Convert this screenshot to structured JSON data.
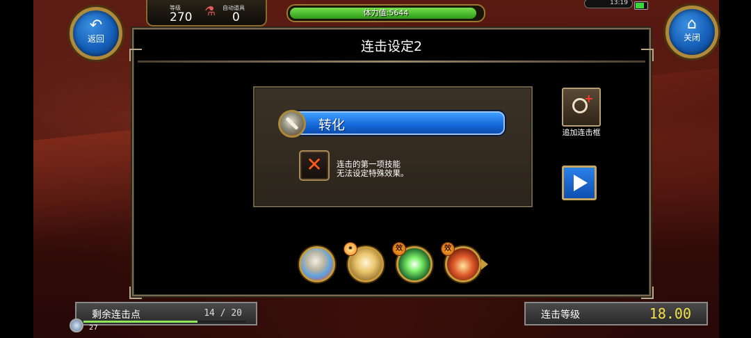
{
  "hud": {
    "back_label": "返回",
    "close_label": "关闭",
    "level_key": "等级",
    "level_value": "270",
    "auto_item_key": "自动道具",
    "auto_item_value": "0",
    "stamina_text": "体力值:5644",
    "stamina_fraction": 0.97,
    "clock_text": "13:19",
    "hp_text": "27"
  },
  "dialog": {
    "title": "连击设定2",
    "selected_skill": "转化",
    "note_line1": "连击的第一项技能",
    "note_line2": "无法设定特殊效果。",
    "add_frame_label": "追加连击框"
  },
  "icons": {
    "back": "back-arrow-icon",
    "close": "home-icon",
    "add_frame": "add-combo-frame-icon",
    "next": "play-icon",
    "remove": "close-x-icon"
  },
  "combo_slots": [
    {
      "name": "skill-slash"
    },
    {
      "name": "skill-horn"
    },
    {
      "name": "skill-green-burst"
    },
    {
      "name": "skill-red-dome"
    }
  ],
  "bottom": {
    "points_label": "剩余连击点",
    "points_value": "14 / 20",
    "points_fraction": 0.7,
    "combo_level_label": "连击等级",
    "combo_level_value": "18.00"
  },
  "colors": {
    "skill_bar": "#1466d8",
    "stamina_fill": "#2f9a1a",
    "level_value": "#f4e04a",
    "frame_gold": "#b08a3a"
  }
}
